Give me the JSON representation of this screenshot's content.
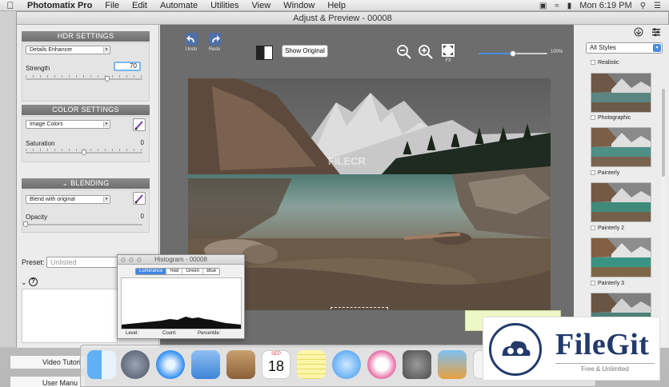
{
  "menubar": {
    "app_name": "Photomatix Pro",
    "items": [
      "File",
      "Edit",
      "Automate",
      "Utilities",
      "View",
      "Window",
      "Help"
    ],
    "clock": "Mon 6:19 PM"
  },
  "window": {
    "title": "Adjust & Preview - 00008"
  },
  "left_panel": {
    "hdr_settings": {
      "title": "HDR SETTINGS",
      "method": "Details Enhancer",
      "strength_label": "Strength",
      "strength_value": "70",
      "strength_level": 0.7
    },
    "color_settings": {
      "title": "COLOR SETTINGS",
      "mode": "Image Colors",
      "saturation_label": "Saturation",
      "saturation_value": "0",
      "saturation_level": 0.5
    },
    "blending": {
      "title": "BLENDING",
      "mode": "Blend with original",
      "opacity_label": "Opacity",
      "opacity_value": "0",
      "opacity_level": 0.0
    },
    "preset": {
      "label": "Preset:",
      "placeholder": "Unlisted"
    },
    "help_symbol": "?",
    "bottom_items": [
      "Video Tutori",
      "User Manu"
    ]
  },
  "toolbar": {
    "undo_label": "Undo",
    "redo_label": "Redo",
    "show_original_label": "Show Original",
    "fit_label": "Fit",
    "zoom_percent": "100%",
    "zoom_level": 0.5
  },
  "photo_watermark_text": "FILECR",
  "styles_panel": {
    "filter": "All Styles",
    "styles": [
      "Realistic",
      "Photographic",
      "Painterly",
      "Painterly 2",
      "Painterly 3"
    ]
  },
  "histogram": {
    "title": "Histogram - 00008",
    "tabs": [
      "Luminance",
      "Red",
      "Green",
      "Blue"
    ],
    "active_tab": "Luminance",
    "footer": [
      "Level:",
      "Count:",
      "Percentile:"
    ]
  },
  "dock": {
    "apps": [
      "finder-icon",
      "launchpad-icon",
      "safari-icon",
      "mail-icon",
      "contacts-icon",
      "calendar-icon",
      "notes-icon",
      "messages-icon",
      "itunes-icon",
      "system-preferences-icon",
      "preview-icon",
      "document-icon"
    ],
    "calendar_month": "SEP",
    "calendar_day": "18"
  },
  "watermark": {
    "brand": "FileGit",
    "tagline": "Free & Unlimited"
  },
  "colors": {
    "accent": "#4a90e2",
    "dark_panel": "#6d6d6d",
    "brand_navy": "#22396a"
  }
}
